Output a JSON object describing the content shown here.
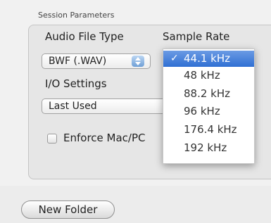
{
  "session_parameters": {
    "group_label": "Session Parameters",
    "audio_file_type": {
      "label": "Audio File Type",
      "value": "BWF (.WAV)"
    },
    "sample_rate": {
      "label": "Sample Rate",
      "options": [
        "44.1 kHz",
        "48 kHz",
        "88.2 kHz",
        "96 kHz",
        "176.4 kHz",
        "192 kHz"
      ],
      "selected": "44.1 kHz",
      "checkmark": "✓"
    },
    "io_settings": {
      "label": "I/O Settings",
      "value": "Last Used"
    },
    "enforce": {
      "label": "Enforce Mac/PC",
      "checked": false
    }
  },
  "footer": {
    "new_folder_label": "New Folder"
  },
  "colors": {
    "selection": "#2f6fd3",
    "stepper": "#6f9fd6"
  }
}
